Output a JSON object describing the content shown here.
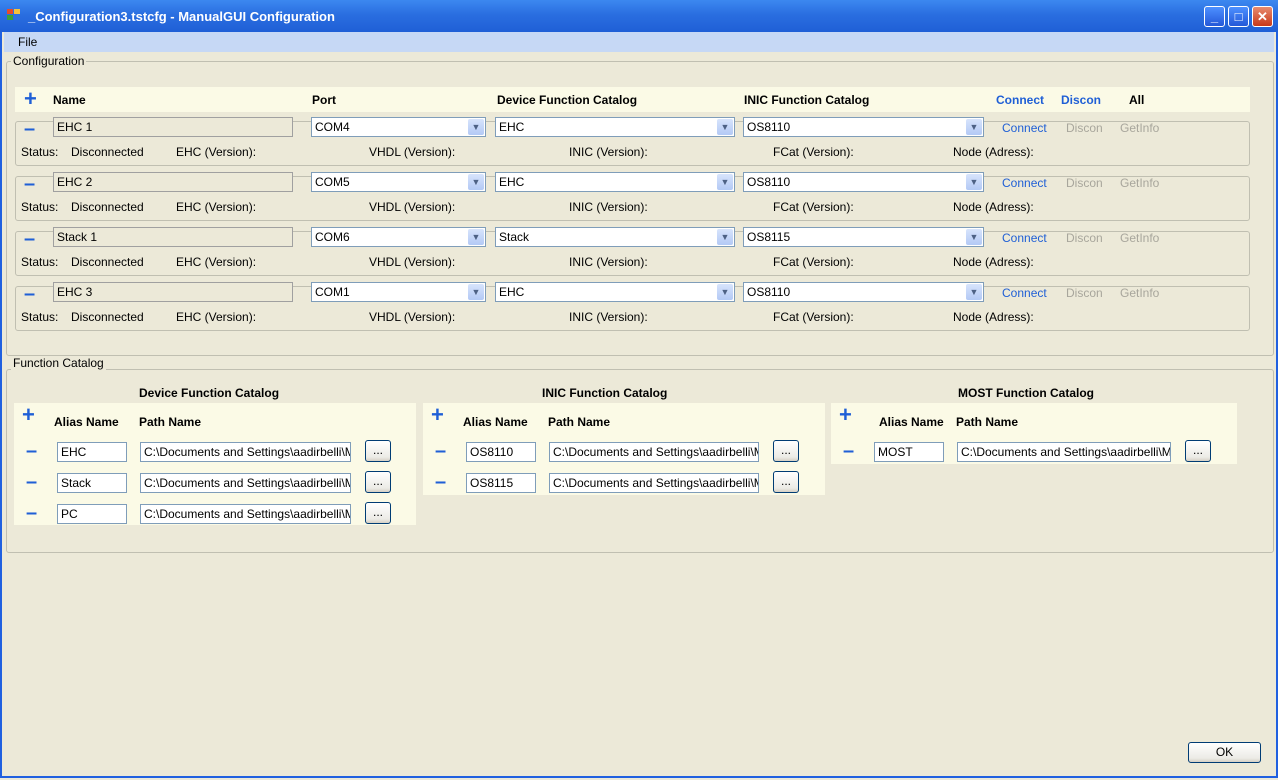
{
  "window": {
    "title": "_Configuration3.tstcfg - ManualGUI Configuration"
  },
  "menu": {
    "file": "File"
  },
  "configuration": {
    "group_label": "Configuration",
    "headers": {
      "name": "Name",
      "port": "Port",
      "device_catalog": "Device Function Catalog",
      "inic_catalog": "INIC Function Catalog",
      "connect": "Connect",
      "discon": "Discon",
      "all": "All"
    },
    "device_labels": {
      "status": "Status:",
      "ehc_version": "EHC (Version):",
      "vhdl_version": "VHDL (Version):",
      "inic_version": "INIC (Version):",
      "fcat_version": "FCat (Version):",
      "node_address": "Node (Adress):",
      "connect": "Connect",
      "discon": "Discon",
      "getinfo": "GetInfo"
    },
    "devices": [
      {
        "name": "EHC 1",
        "port": "COM4",
        "device_catalog": "EHC",
        "inic_catalog": "OS8110",
        "status": "Disconnected"
      },
      {
        "name": "EHC 2",
        "port": "COM5",
        "device_catalog": "EHC",
        "inic_catalog": "OS8110",
        "status": "Disconnected"
      },
      {
        "name": "Stack 1",
        "port": "COM6",
        "device_catalog": "Stack",
        "inic_catalog": "OS8115",
        "status": "Disconnected"
      },
      {
        "name": "EHC 3",
        "port": "COM1",
        "device_catalog": "EHC",
        "inic_catalog": "OS8110",
        "status": "Disconnected"
      }
    ]
  },
  "function_catalog": {
    "group_label": "Function Catalog",
    "alias_header": "Alias Name",
    "path_header": "Path Name",
    "browse_label": "...",
    "device": {
      "title": "Device Function Catalog",
      "rows": [
        {
          "alias": "EHC",
          "path": "C:\\Documents and Settings\\aadirbelli\\My"
        },
        {
          "alias": "Stack",
          "path": "C:\\Documents and Settings\\aadirbelli\\My"
        },
        {
          "alias": "PC",
          "path": "C:\\Documents and Settings\\aadirbelli\\My"
        }
      ]
    },
    "inic": {
      "title": "INIC Function Catalog",
      "rows": [
        {
          "alias": "OS8110",
          "path": "C:\\Documents and Settings\\aadirbelli\\My"
        },
        {
          "alias": "OS8115",
          "path": "C:\\Documents and Settings\\aadirbelli\\My"
        }
      ]
    },
    "most": {
      "title": "MOST Function Catalog",
      "rows": [
        {
          "alias": "MOST",
          "path": "C:\\Documents and Settings\\aadirbelli\\My D"
        }
      ]
    }
  },
  "footer": {
    "ok": "OK"
  },
  "colors": {
    "accent": "#1f5fd6",
    "panel": "#fbfae6",
    "background": "#ece9d8"
  }
}
